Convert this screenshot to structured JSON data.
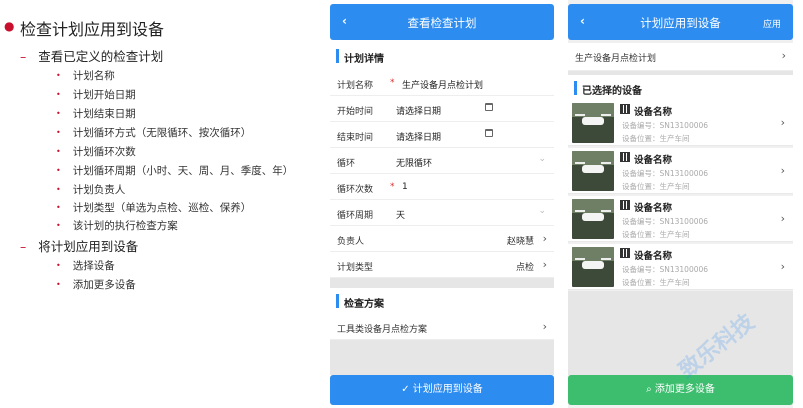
{
  "outline": {
    "title": "检查计划应用到设备",
    "sections": [
      {
        "heading": "查看已定义的检查计划",
        "items": [
          "计划名称",
          "计划开始日期",
          "计划结束日期",
          "计划循环方式（无限循环、按次循环）",
          "计划循环次数",
          "计划循环周期（小时、天、周、月、季度、年）",
          "计划负责人",
          "计划类型（单选为点检、巡检、保养）",
          "该计划的执行检查方案"
        ]
      },
      {
        "heading": "将计划应用到设备",
        "items": [
          "选择设备",
          "添加更多设备"
        ]
      }
    ]
  },
  "screen1": {
    "back": "‹",
    "title": "查看检查计划",
    "section_plan": "计划详情",
    "fields": {
      "name": {
        "label": "计划名称",
        "value": "生产设备月点检计划"
      },
      "start": {
        "label": "开始时间",
        "value": "请选择日期"
      },
      "end": {
        "label": "结束时间",
        "value": "请选择日期"
      },
      "loop": {
        "label": "循环",
        "value": "无限循环"
      },
      "count": {
        "label": "循环次数",
        "value": "1"
      },
      "period": {
        "label": "循环周期",
        "value": "天"
      },
      "owner": {
        "label": "负责人",
        "value": "赵晓慧"
      },
      "type": {
        "label": "计划类型",
        "value": "点检"
      }
    },
    "section_scheme": "检查方案",
    "scheme": "工具类设备月点检方案",
    "apply_button": "计划应用到设备",
    "apply_icon": "check-icon"
  },
  "screen2": {
    "back": "‹",
    "title": "计划应用到设备",
    "action": "应用",
    "plan_row": "生产设备月点检计划",
    "section_selected": "已选择的设备",
    "devices": [
      {
        "name": "设备名称",
        "sn": "设备编号：SN13100006",
        "loc": "设备位置：生产车间"
      },
      {
        "name": "设备名称",
        "sn": "设备编号：SN13100006",
        "loc": "设备位置：生产车间"
      },
      {
        "name": "设备名称",
        "sn": "设备编号：SN13100006",
        "loc": "设备位置：生产车间"
      },
      {
        "name": "设备名称",
        "sn": "设备编号：SN13100006",
        "loc": "设备位置：生产车间"
      }
    ],
    "add_button": "添加更多设备",
    "add_icon": "search-icon"
  },
  "watermark": "致乐科技",
  "colors": {
    "accent": "#2d8cf0",
    "green": "#3dbd6e",
    "bullet": "#c8102e",
    "required": "#e03030"
  }
}
